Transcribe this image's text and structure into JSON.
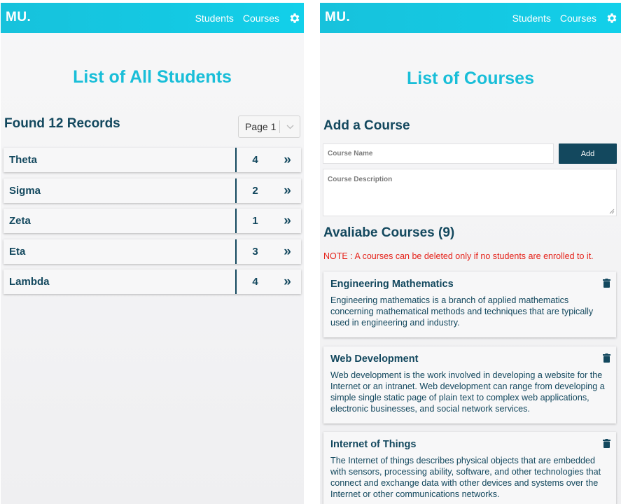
{
  "nav": {
    "brand": "MU.",
    "links": [
      "Students",
      "Courses"
    ],
    "settings_icon": "gear-icon"
  },
  "students_page": {
    "title": "List of All Students",
    "records_label": "Found 12 Records",
    "page_select": {
      "value": "Page 1"
    },
    "students": [
      {
        "name": "Theta",
        "count": "4",
        "arrow": "»"
      },
      {
        "name": "Sigma",
        "count": "2",
        "arrow": "»"
      },
      {
        "name": "Zeta",
        "count": "1",
        "arrow": "»"
      },
      {
        "name": "Eta",
        "count": "3",
        "arrow": "»"
      },
      {
        "name": "Lambda",
        "count": "4",
        "arrow": "»"
      }
    ]
  },
  "courses_page": {
    "title": "List of Courses",
    "add_heading": "Add a Course",
    "course_name_placeholder": "Course Name",
    "add_button": "Add",
    "course_description_placeholder": "Course Description",
    "available_heading": "Avaliabe Courses (9)",
    "note": "NOTE : A courses can be deleted only if no students are enrolled to it.",
    "courses": [
      {
        "title": "Engineering Mathematics",
        "description": "Engineering mathematics is a branch of applied mathematics concerning mathematical methods and techniques that are typically used in engineering and industry."
      },
      {
        "title": "Web Development",
        "description": "Web development is the work involved in developing a website for the Internet or an intranet. Web development can range from developing a simple single static page of plain text to complex web applications, electronic businesses, and social network services."
      },
      {
        "title": "Internet of Things",
        "description": "The Internet of things describes physical objects that are embedded with sensors, processing ability, software, and other technologies that connect and exchange data with other devices and systems over the Internet or other communications networks."
      }
    ]
  },
  "colors": {
    "navbar": "#17c2dc",
    "title": "#19bed8",
    "primary_text": "#13485e",
    "button": "#13485e",
    "note": "#e5231a"
  }
}
